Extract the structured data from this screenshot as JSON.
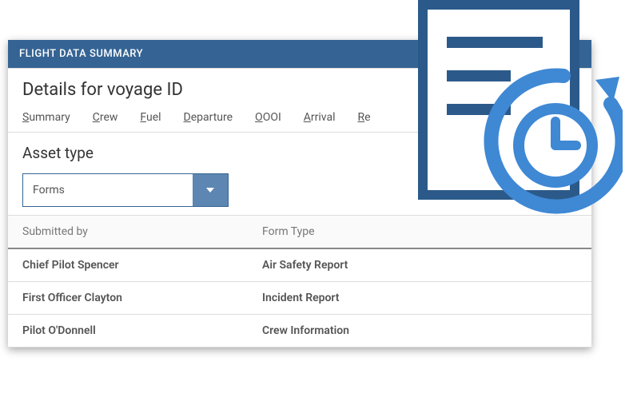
{
  "header": {
    "title": "FLIGHT DATA SUMMARY"
  },
  "page": {
    "title": "Details for voyage ID"
  },
  "tabs": [
    {
      "label": "Summary",
      "key": "S"
    },
    {
      "label": "Crew",
      "key": "C"
    },
    {
      "label": "Fuel",
      "key": "F"
    },
    {
      "label": "Departure",
      "key": "D"
    },
    {
      "label": "OOOI",
      "key": "O"
    },
    {
      "label": "Arrival",
      "key": "A"
    },
    {
      "label": "Re",
      "key": "R"
    }
  ],
  "asset": {
    "title": "Asset type",
    "dropdown": {
      "selected": "Forms"
    }
  },
  "table": {
    "headers": {
      "col1": "Submitted by",
      "col2": "Form Type"
    },
    "rows": [
      {
        "col1": "Chief Pilot Spencer",
        "col2": "Air Safety Report"
      },
      {
        "col1": "First Officer Clayton",
        "col2": "Incident Report"
      },
      {
        "col1": "Pilot O'Donnell",
        "col2": "Crew Information"
      }
    ]
  },
  "colors": {
    "brand": "#356494",
    "accent": "#3f88d4"
  },
  "heroIcon": "document-history-icon"
}
